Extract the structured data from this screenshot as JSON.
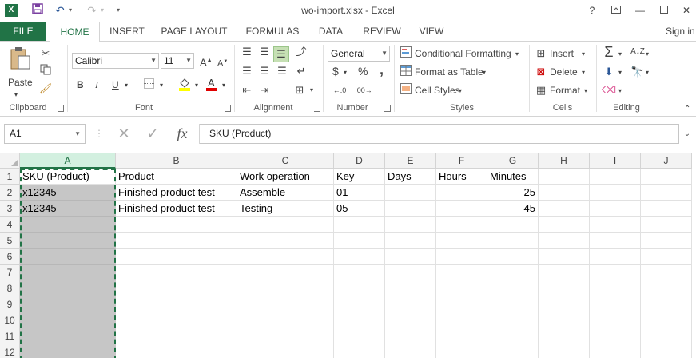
{
  "titlebar": {
    "logo": "X",
    "title": "wo-import.xlsx - Excel",
    "help": "?",
    "icons": [
      "excel-logo-icon",
      "save-icon",
      "undo-icon",
      "redo-icon",
      "customize-qat-icon",
      "help-icon",
      "ribbon-display-icon",
      "minimize-icon",
      "maximize-icon",
      "close-icon"
    ]
  },
  "tabs": {
    "file": "FILE",
    "items": [
      "HOME",
      "INSERT",
      "PAGE LAYOUT",
      "FORMULAS",
      "DATA",
      "REVIEW",
      "VIEW"
    ],
    "active": "HOME",
    "signin": "Sign in"
  },
  "ribbon": {
    "clipboard": {
      "label": "Clipboard",
      "paste": "Paste"
    },
    "font": {
      "label": "Font",
      "name": "Calibri",
      "size": "11",
      "bold": "B",
      "italic": "I",
      "underline": "U",
      "grow": "A",
      "shrink": "A"
    },
    "alignment": {
      "label": "Alignment"
    },
    "number": {
      "label": "Number",
      "format": "General",
      "currency": "$",
      "percent": "%",
      "comma": ","
    },
    "styles": {
      "label": "Styles",
      "conditional": "Conditional Formatting",
      "table": "Format as Table",
      "cell_styles": "Cell Styles"
    },
    "cells": {
      "label": "Cells",
      "insert": "Insert",
      "delete": "Delete",
      "format": "Format"
    },
    "editing": {
      "label": "Editing"
    }
  },
  "formula_bar": {
    "name_box": "A1",
    "fx": "fx",
    "value": "SKU (Product)"
  },
  "sheet": {
    "columns": [
      "A",
      "B",
      "C",
      "D",
      "E",
      "F",
      "G",
      "H",
      "I",
      "J"
    ],
    "selected_column": "A",
    "rows": [
      "1",
      "2",
      "3",
      "4",
      "5",
      "6",
      "7",
      "8",
      "9",
      "10",
      "11",
      "12"
    ],
    "cells": {
      "A1": "SKU (Product)",
      "B1": "Product",
      "C1": "Work operation",
      "D1": "Key",
      "E1": "Days",
      "F1": "Hours",
      "G1": "Minutes",
      "A2": "x12345",
      "B2": "Finished product test",
      "C2": "Assemble",
      "D2": "01",
      "G2": "25",
      "A3": "x12345",
      "B3": "Finished product test",
      "C3": "Testing",
      "D3": "05",
      "G3": "45"
    }
  },
  "colors": {
    "accent": "#217346",
    "selection": "#c6c6c6"
  }
}
